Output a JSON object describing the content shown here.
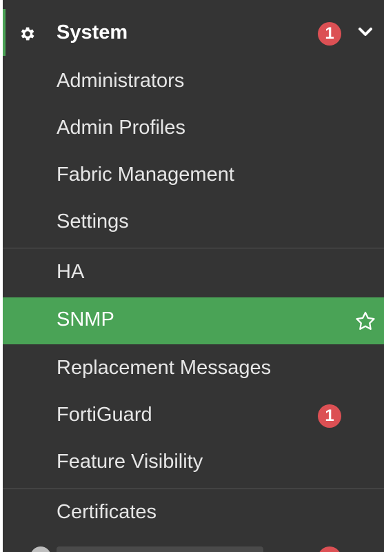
{
  "menu": {
    "section_title": "System",
    "section_badge": "1",
    "items": [
      {
        "label": "Administrators"
      },
      {
        "label": "Admin Profiles"
      },
      {
        "label": "Fabric Management"
      },
      {
        "label": "Settings"
      },
      {
        "label": "HA"
      },
      {
        "label": "SNMP",
        "active": true
      },
      {
        "label": "Replacement Messages"
      },
      {
        "label": "FortiGuard",
        "badge": "1"
      },
      {
        "label": "Feature Visibility"
      },
      {
        "label": "Certificates"
      }
    ]
  },
  "icons": {
    "section": "gear-icon",
    "expand": "chevron-down-icon",
    "favorite": "star-outline-icon",
    "next_section": "globe-icon"
  },
  "colors": {
    "sidebar_bg": "#343434",
    "active_bg": "#4aa356",
    "badge_bg": "#dc5054",
    "text": "#e6e6e6"
  }
}
